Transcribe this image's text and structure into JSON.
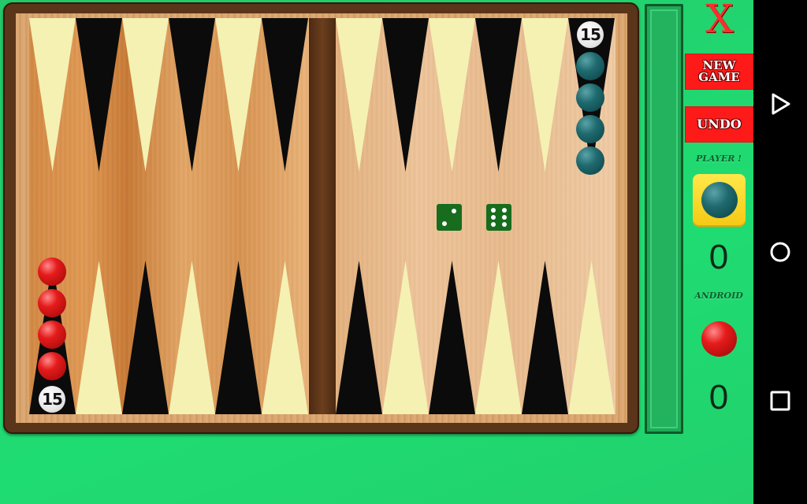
{
  "board": {
    "top_left_count": "",
    "top_right_count": "15",
    "bottom_left_count": "15",
    "dice": [
      2,
      6
    ]
  },
  "side": {
    "close_label": "X",
    "new_game_label": "NEW GAME",
    "undo_label": "UNDO",
    "player_label": "PLAYER !",
    "player_score": "0",
    "android_label": "ANDROID",
    "android_score": "0"
  },
  "navbar": {
    "back": "back-icon",
    "home": "home-icon",
    "recents": "recents-icon"
  },
  "colors": {
    "red_checker": "#e51b1b",
    "teal_checker": "#1f6a6f",
    "button_red": "#ff1a1a",
    "background_green": "#1fdc72"
  }
}
